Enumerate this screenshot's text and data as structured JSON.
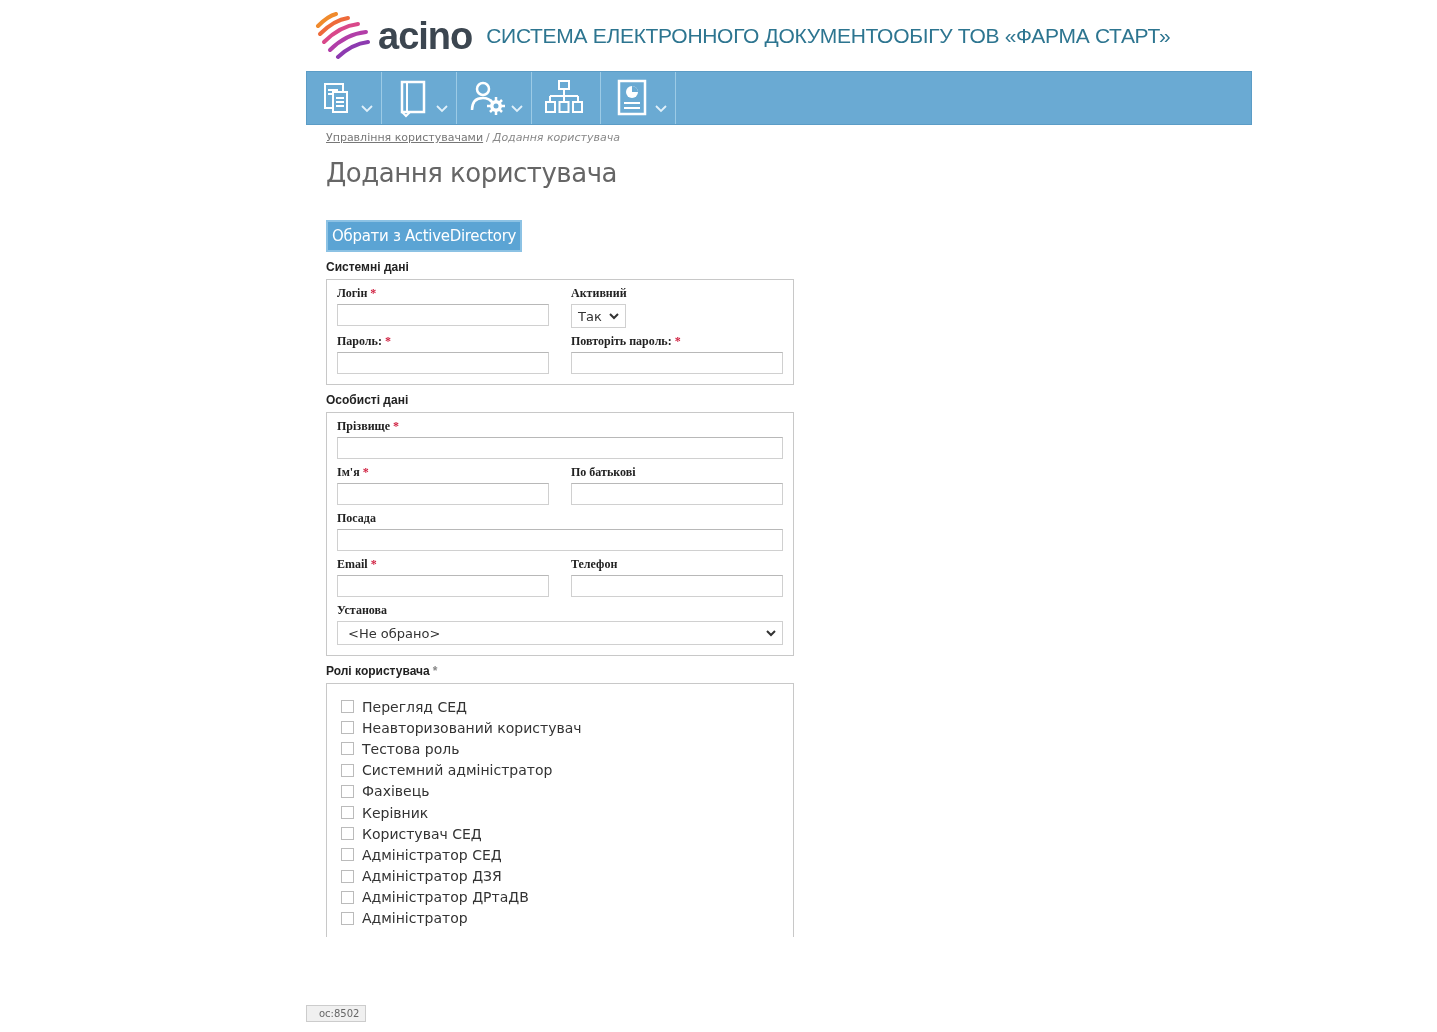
{
  "header": {
    "logo_text": "acino",
    "system_title": "СИСТЕМА ЕЛЕКТРОННОГО ДОКУМЕНТООБІГУ ТОВ «ФАРМА СТАРТ»"
  },
  "toolbar": {
    "items": [
      {
        "dropdown": true
      },
      {
        "dropdown": true
      },
      {
        "dropdown": true
      },
      {
        "dropdown": false
      },
      {
        "dropdown": true
      }
    ]
  },
  "breadcrumb": {
    "link": "Управління користувачами",
    "separator": "/",
    "current": "Додання користувача"
  },
  "page_title": "Додання користувача",
  "ad_button": "Обрати з ActiveDirectory",
  "sections": [
    {
      "title": "Системні дані",
      "rows": [
        [
          {
            "label": "Логін",
            "marker": "*",
            "kind": "text"
          },
          {
            "label": "Активний",
            "kind": "select-small",
            "value": "Так"
          }
        ],
        [
          {
            "label": "Пароль:",
            "marker": "*",
            "kind": "password"
          },
          {
            "label": "Повторіть пароль:",
            "marker": "*",
            "kind": "password"
          }
        ]
      ]
    },
    {
      "title": "Особисті дані",
      "rows": [
        [
          {
            "label": "Прізвище",
            "marker": "*",
            "kind": "text"
          }
        ],
        [
          {
            "label": "Ім'я",
            "marker": "*",
            "kind": "text"
          },
          {
            "label": "По батькові",
            "kind": "text"
          }
        ],
        [
          {
            "label": "Посада",
            "kind": "text"
          }
        ],
        [
          {
            "label": "Email",
            "marker": "*",
            "kind": "text"
          },
          {
            "label": "Телефон",
            "kind": "text"
          }
        ],
        [
          {
            "label": "Установа",
            "kind": "select",
            "value": "<Не обрано>"
          }
        ]
      ]
    }
  ],
  "roles": {
    "title": "Ролі користувача",
    "marker": "*",
    "items": [
      {
        "label": "Перегляд СЕД",
        "checked": false
      },
      {
        "label": "Неавторизований користувач",
        "checked": false
      },
      {
        "label": "Тестова роль",
        "checked": false
      },
      {
        "label": "Системний адміністратор",
        "checked": false
      },
      {
        "label": "Фахівець",
        "checked": false
      },
      {
        "label": "Керівник",
        "checked": false
      },
      {
        "label": "Користувач СЕД",
        "checked": false
      },
      {
        "label": "Адміністратор СЕД",
        "checked": false
      },
      {
        "label": "Адміністратор ДЗЯ",
        "checked": false
      },
      {
        "label": "Адміністратор ДРтаДВ",
        "checked": false
      },
      {
        "label": "Адміністратор",
        "checked": false
      }
    ]
  },
  "status_url": "oc:8502"
}
